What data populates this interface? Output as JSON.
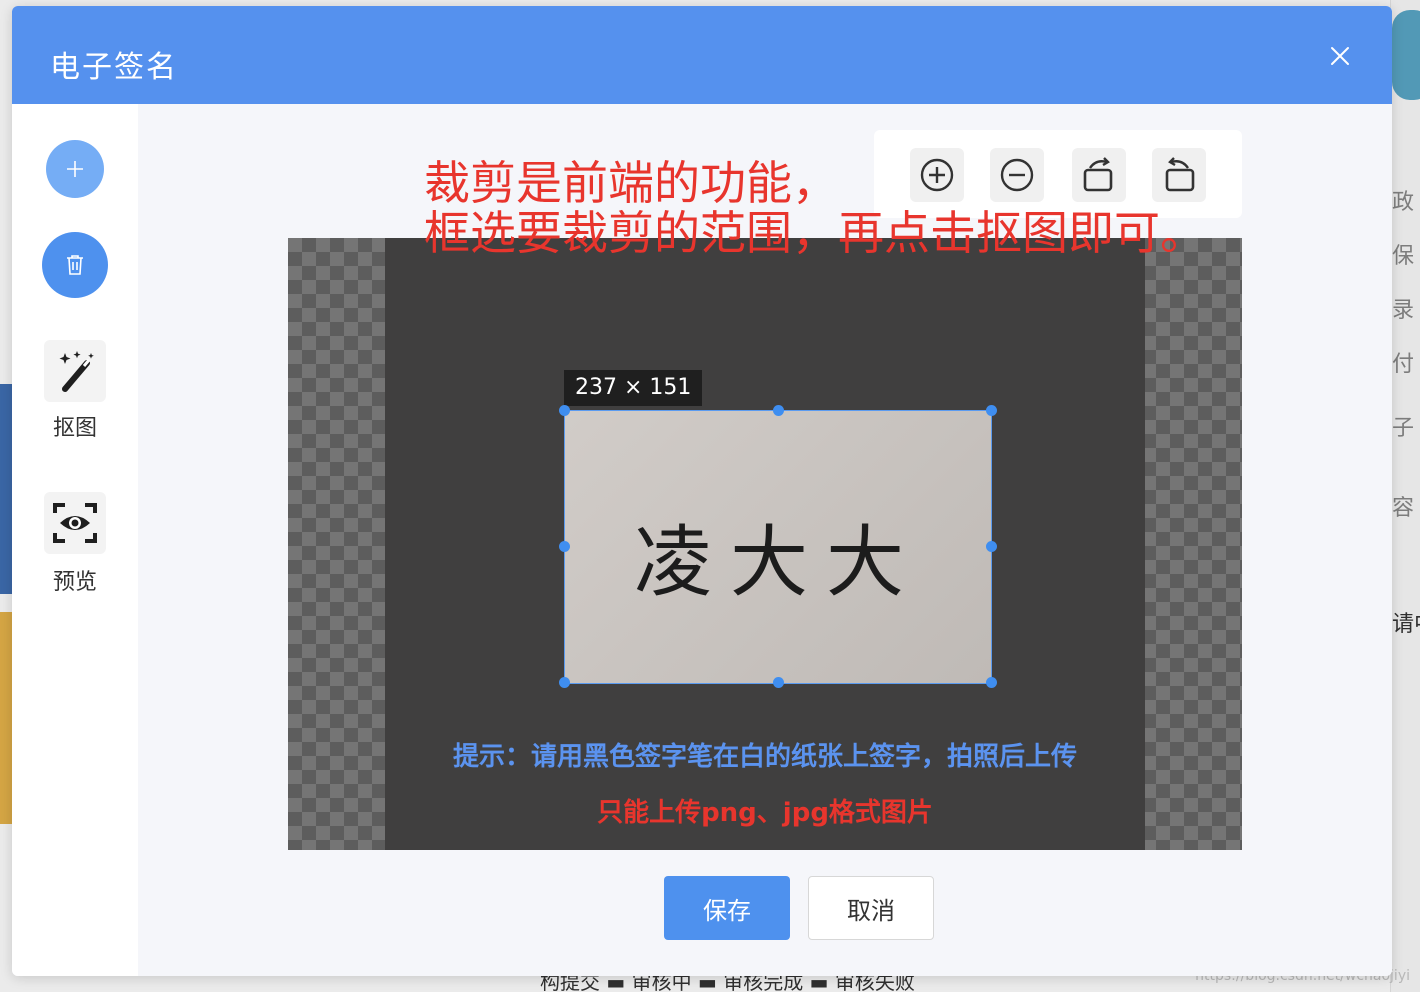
{
  "dialog": {
    "title": "电子签名",
    "sidebar": {
      "cutout_label": "抠图",
      "preview_label": "预览"
    },
    "annotation": {
      "line1": "裁剪是前端的功能，",
      "line2": "框选要裁剪的范围，再点击抠图即可。"
    },
    "crop": {
      "size_label": "237 × 151",
      "signature_text": "凌大大"
    },
    "tips": {
      "line1": "提示：请用黑色签字笔在白的纸张上签字，拍照后上传",
      "line2": "只能上传png、jpg格式图片"
    },
    "buttons": {
      "save": "保存",
      "cancel": "取消"
    }
  },
  "background": {
    "right_fragments": [
      "政",
      "保",
      "录",
      "付",
      "子",
      "容",
      "请中"
    ],
    "bottom_fragments": "构提交  ▬ 审核中  ▬ 审核完成  ▬ 审核失败",
    "watermark": "https://blog.csdn.net/wchaojiyi"
  },
  "colors": {
    "header": "#5591ee",
    "primary": "#4e91ee",
    "annotation_red": "#e8352d",
    "tip_blue": "#5b93ef"
  }
}
